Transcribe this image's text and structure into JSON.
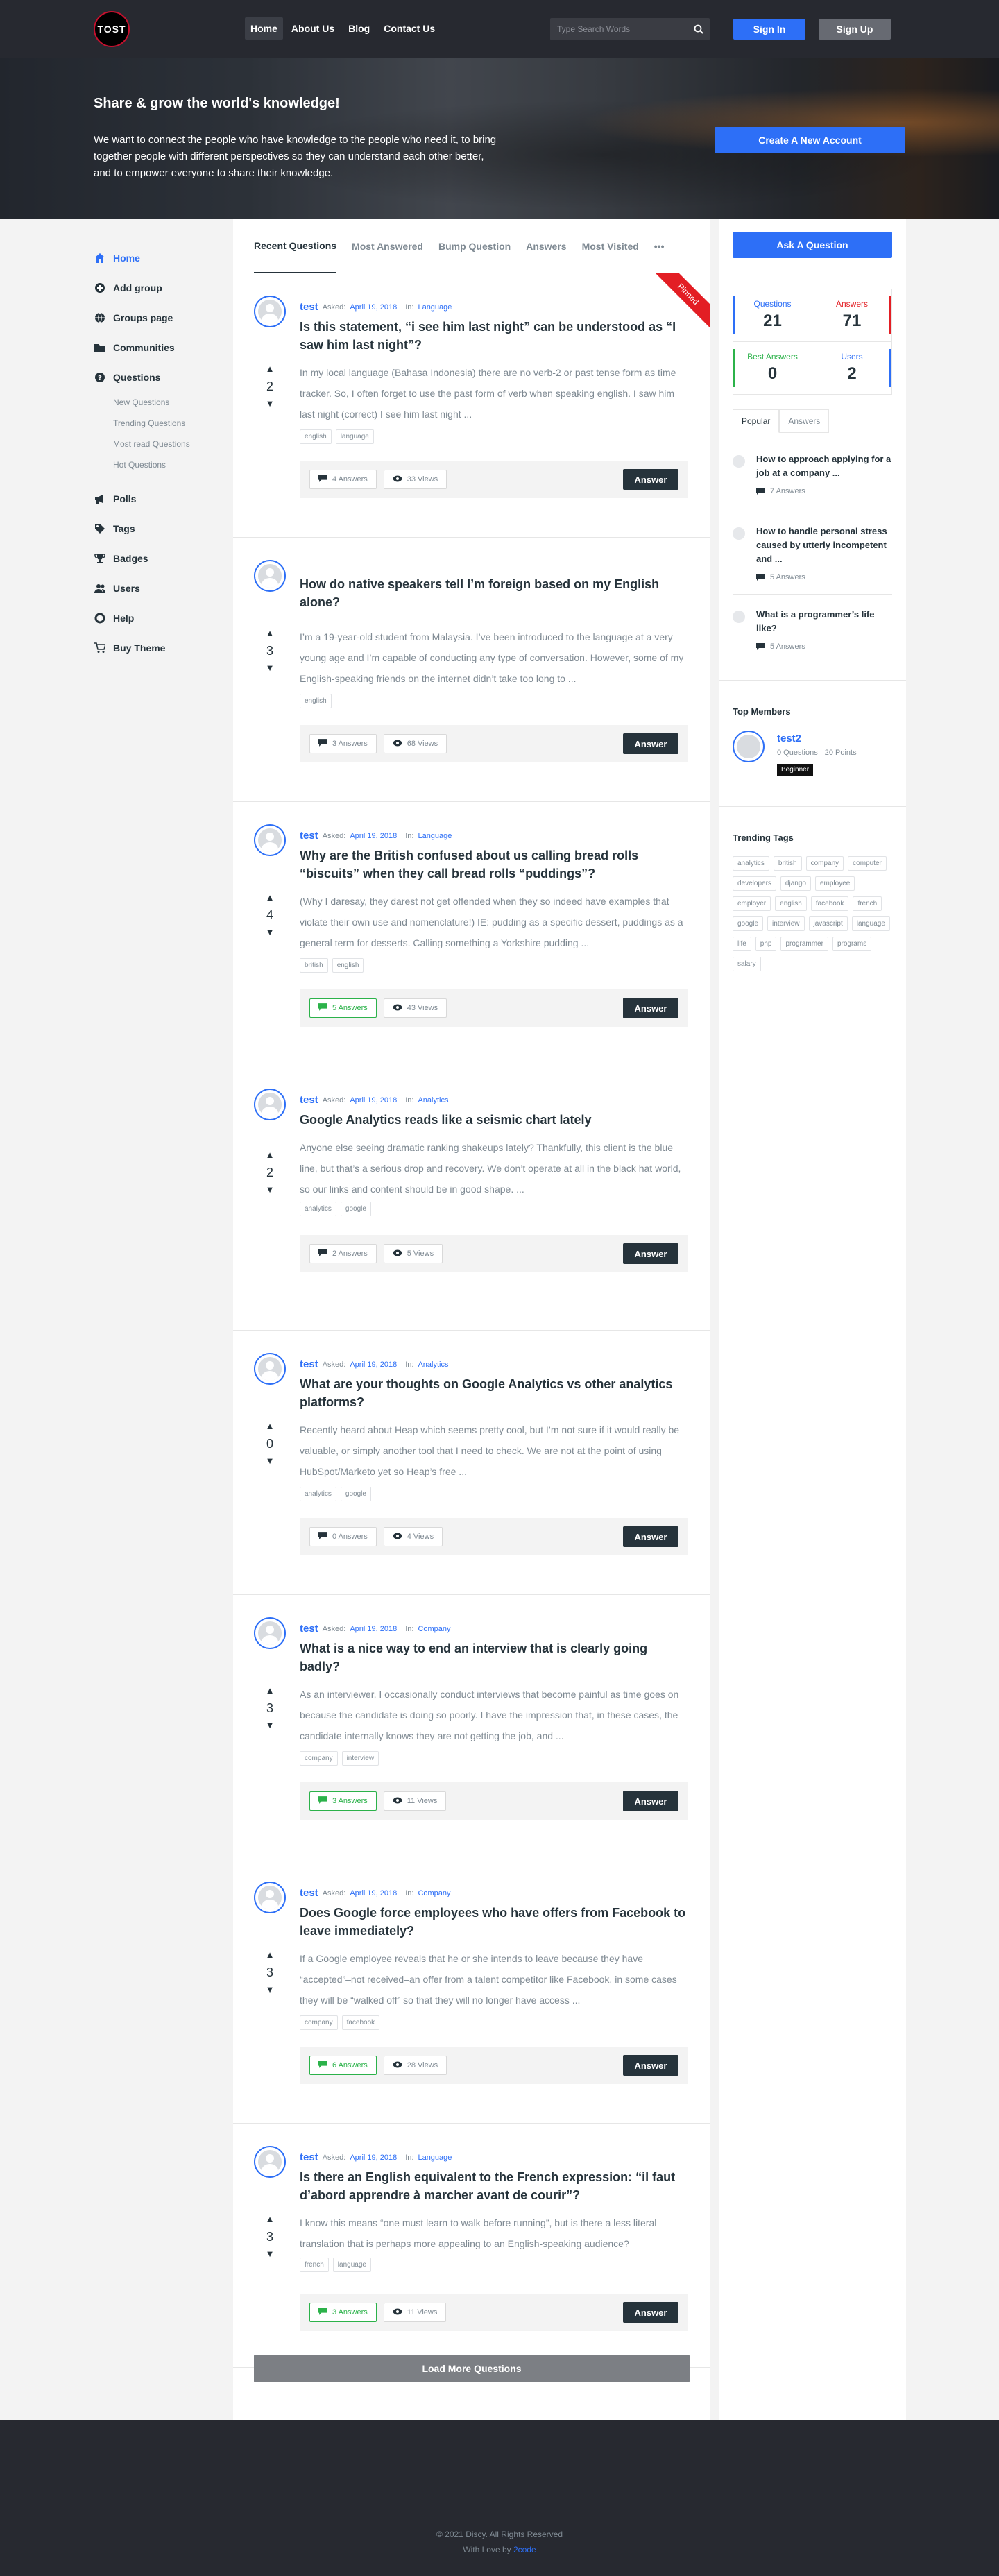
{
  "header": {
    "logo_text": "TOST",
    "nav": [
      "Home",
      "About Us",
      "Blog",
      "Contact Us"
    ],
    "search_placeholder": "Type Search Words",
    "sign_in": "Sign In",
    "sign_up": "Sign Up"
  },
  "hero": {
    "title": "Share & grow the world's knowledge!",
    "text": "We want to connect the people who have knowledge to the people who need it, to bring together people with different perspectives so they can understand each other better, and to empower everyone to share their knowledge.",
    "button": "Create A New Account"
  },
  "sidebar": {
    "items": [
      {
        "label": "Home",
        "icon": "home-icon"
      },
      {
        "label": "Add group",
        "icon": "add-group-icon"
      },
      {
        "label": "Groups page",
        "icon": "globe-icon"
      },
      {
        "label": "Communities",
        "icon": "folder-icon"
      },
      {
        "label": "Questions",
        "icon": "question-icon"
      },
      {
        "label": "Polls",
        "icon": "megaphone-icon"
      },
      {
        "label": "Tags",
        "icon": "tag-icon"
      },
      {
        "label": "Badges",
        "icon": "trophy-icon"
      },
      {
        "label": "Users",
        "icon": "users-icon"
      },
      {
        "label": "Help",
        "icon": "lifebuoy-icon"
      },
      {
        "label": "Buy Theme",
        "icon": "cart-icon"
      }
    ],
    "sub_items": [
      "New Questions",
      "Trending Questions",
      "Most read Questions",
      "Hot Questions"
    ]
  },
  "tabs": [
    "Recent Questions",
    "Most Answered",
    "Bump Question",
    "Answers",
    "Most Visited",
    "•••"
  ],
  "questions": [
    {
      "user": "test",
      "asked": "Asked:",
      "date": "April 19, 2018",
      "in": "In:",
      "category": "Language",
      "title": "Is this statement, “i see him last night” can be understood as “I saw him last night”?",
      "excerpt": "In my local language (Bahasa Indonesia) there are no verb-2 or past tense form as time tracker. So, I often forget to use the past form of verb when speaking english. I saw him last night (correct) I see him last night ...",
      "votes": "2",
      "tags": [
        "english",
        "language"
      ],
      "answers": "4 Answers",
      "views": "33 Views",
      "answer_btn": "Answer",
      "pinned": "Pinned"
    },
    {
      "user": "",
      "asked": "",
      "date": "",
      "in": "",
      "category": "",
      "title": "How do native speakers tell I’m foreign based on my English alone?",
      "excerpt": "I’m a 19-year-old student from Malaysia. I’ve been introduced to the language at a very young age and I’m capable of conducting any type of conversation. However, some of my English-speaking friends on the internet didn’t take too long to ...",
      "votes": "3",
      "tags": [
        "english"
      ],
      "answers": "3 Answers",
      "views": "68 Views",
      "answer_btn": "Answer"
    },
    {
      "user": "test",
      "asked": "Asked:",
      "date": "April 19, 2018",
      "in": "In:",
      "category": "Language",
      "title": "Why are the British confused about us calling bread rolls “biscuits” when they call bread rolls “puddings”?",
      "excerpt": "(Why I daresay, they darest not get offended when they so indeed have examples that violate their own use and nomenclature!) IE: pudding as a specific dessert, puddings as a general term for desserts. Calling something a Yorkshire pudding ...",
      "votes": "4",
      "tags": [
        "british",
        "english"
      ],
      "answers": "5 Answers",
      "views": "43 Views",
      "answer_btn": "Answer"
    },
    {
      "user": "test",
      "asked": "Asked:",
      "date": "April 19, 2018",
      "in": "In:",
      "category": "Analytics",
      "title": "Google Analytics reads like a seismic chart lately",
      "excerpt": "Anyone else seeing dramatic ranking shakeups lately? Thankfully, this client is the blue line, but that’s a serious drop and recovery. We don’t operate at all in the black hat world, so our links and content should be in good shape. ...",
      "votes": "2",
      "tags": [
        "analytics",
        "google"
      ],
      "answers": "2 Answers",
      "views": "5 Views",
      "answer_btn": "Answer"
    },
    {
      "user": "test",
      "asked": "Asked:",
      "date": "April 19, 2018",
      "in": "In:",
      "category": "Analytics",
      "title": "What are your thoughts on Google Analytics vs other analytics platforms?",
      "excerpt": "Recently heard about Heap which seems pretty cool, but I’m not sure if it would really be valuable, or simply another tool that I need to check. We are not at the point of using HubSpot/Marketo yet so Heap’s free ...",
      "votes": "0",
      "tags": [
        "analytics",
        "google"
      ],
      "answers": "0 Answers",
      "views": "4 Views",
      "answer_btn": "Answer"
    },
    {
      "user": "test",
      "asked": "Asked:",
      "date": "April 19, 2018",
      "in": "In:",
      "category": "Company",
      "title": "What is a nice way to end an interview that is clearly going badly?",
      "excerpt": "As an interviewer, I occasionally conduct interviews that become painful as time goes on because the candidate is doing so poorly. I have the impression that, in these cases, the candidate internally knows they are not getting the job, and ...",
      "votes": "3",
      "tags": [
        "company",
        "interview"
      ],
      "answers": "3 Answers",
      "views": "11 Views",
      "answer_btn": "Answer"
    },
    {
      "user": "test",
      "asked": "Asked:",
      "date": "April 19, 2018",
      "in": "In:",
      "category": "Company",
      "title": "Does Google force employees who have offers from Facebook to leave immediately?",
      "excerpt": "If a Google employee reveals that he or she intends to leave because they have “accepted”–not received–an offer from a talent competitor like Facebook, in some cases they will be “walked off” so that they will no longer have access ...",
      "votes": "3",
      "tags": [
        "company",
        "facebook"
      ],
      "answers": "6 Answers",
      "views": "28 Views",
      "answer_btn": "Answer"
    },
    {
      "user": "test",
      "asked": "Asked:",
      "date": "April 19, 2018",
      "in": "In:",
      "category": "Language",
      "title": "Is there an English equivalent to the French expression: “il faut d’abord apprendre à marcher avant de courir”?",
      "excerpt": "I know this means “one must learn to walk before running”, but is there a less literal translation that is perhaps more appealing to an English-speaking audience?",
      "votes": "3",
      "tags": [
        "french",
        "language"
      ],
      "answers": "3 Answers",
      "views": "11 Views",
      "answer_btn": "Answer"
    }
  ],
  "load_more": "Load More Questions",
  "right": {
    "ask_button": "Ask A Question",
    "stats": [
      {
        "label": "Questions",
        "value": "21",
        "color": "#2d6ff7"
      },
      {
        "label": "Answers",
        "value": "71",
        "color": "#e31e24"
      },
      {
        "label": "Best Answers",
        "value": "0",
        "color": "#2cb24a"
      },
      {
        "label": "Users",
        "value": "2",
        "color": "#2d6ff7"
      }
    ],
    "popular_tabs": [
      "Popular",
      "Answers"
    ],
    "popular": [
      {
        "title": "How to approach applying for a job at a company ...",
        "answers": "7 Answers"
      },
      {
        "title": "How to handle personal stress caused by utterly incompetent and ...",
        "answers": "5 Answers"
      },
      {
        "title": "What is a programmer’s life like?",
        "answers": "5 Answers"
      }
    ],
    "top_members_title": "Top Members",
    "member": {
      "name": "test2",
      "questions": "0 Questions",
      "points": "20 Points",
      "badge": "Beginner"
    },
    "trending_title": "Trending Tags",
    "trending_tags": [
      "analytics",
      "british",
      "company",
      "computer",
      "developers",
      "django",
      "employee",
      "employer",
      "english",
      "facebook",
      "french",
      "google",
      "interview",
      "javascript",
      "language",
      "life",
      "php",
      "programmer",
      "programs",
      "salary"
    ]
  },
  "footer": {
    "copyright": "© 2021 Discy. All Rights Reserved",
    "with_love": "With Love by",
    "brand": "2code"
  }
}
